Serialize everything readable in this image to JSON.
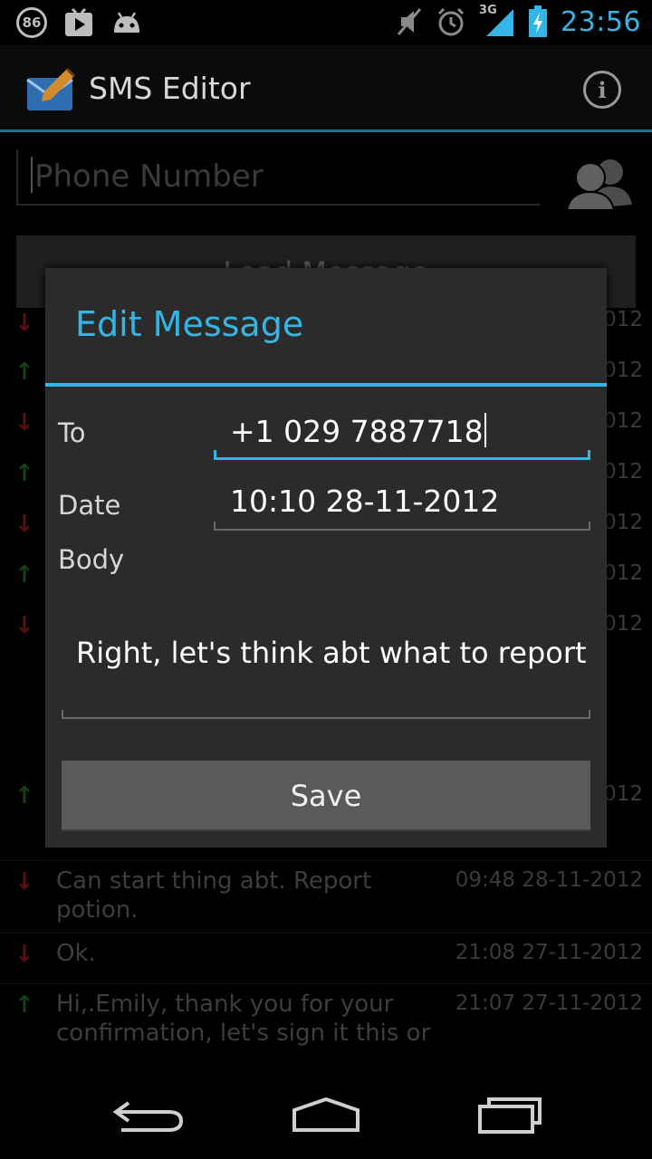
{
  "status_bar": {
    "notification_badge": "86",
    "time": "23:56",
    "network": "3G",
    "icons": [
      "badge-86-icon",
      "play-store-icon",
      "android-icon",
      "mute-icon",
      "alarm-icon",
      "signal-icon",
      "battery-charging-icon"
    ]
  },
  "app_bar": {
    "title": "SMS Editor",
    "info_label": "i"
  },
  "background": {
    "phone_placeholder": "Phone Number",
    "load_button": "Load Message",
    "partial_dates": [
      "012",
      "012",
      "012",
      "012",
      "012",
      "012",
      "012",
      "012"
    ],
    "messages": [
      {
        "direction": "in",
        "body": "Can start thing abt. Report potion.",
        "date": "09:48 28-11-2012"
      },
      {
        "direction": "in",
        "body": " Ok.",
        "date": "21:08 27-11-2012"
      },
      {
        "direction": "out",
        "body": "Hi,.Emily, thank you for your confirmation, let's sign it this or",
        "date": "21:07 27-11-2012"
      }
    ]
  },
  "dialog": {
    "title": "Edit Message",
    "to_label": "To",
    "to_value": "+1 029 7887718",
    "date_label": "Date",
    "date_value": "10:10 28-11-2012",
    "body_label": "Body",
    "body_value": "Right, let's think abt what to report",
    "save_label": "Save"
  },
  "colors": {
    "accent": "#33b5e5",
    "incoming_arrow": "#a01e1e",
    "outgoing_arrow": "#1e7a1e"
  }
}
